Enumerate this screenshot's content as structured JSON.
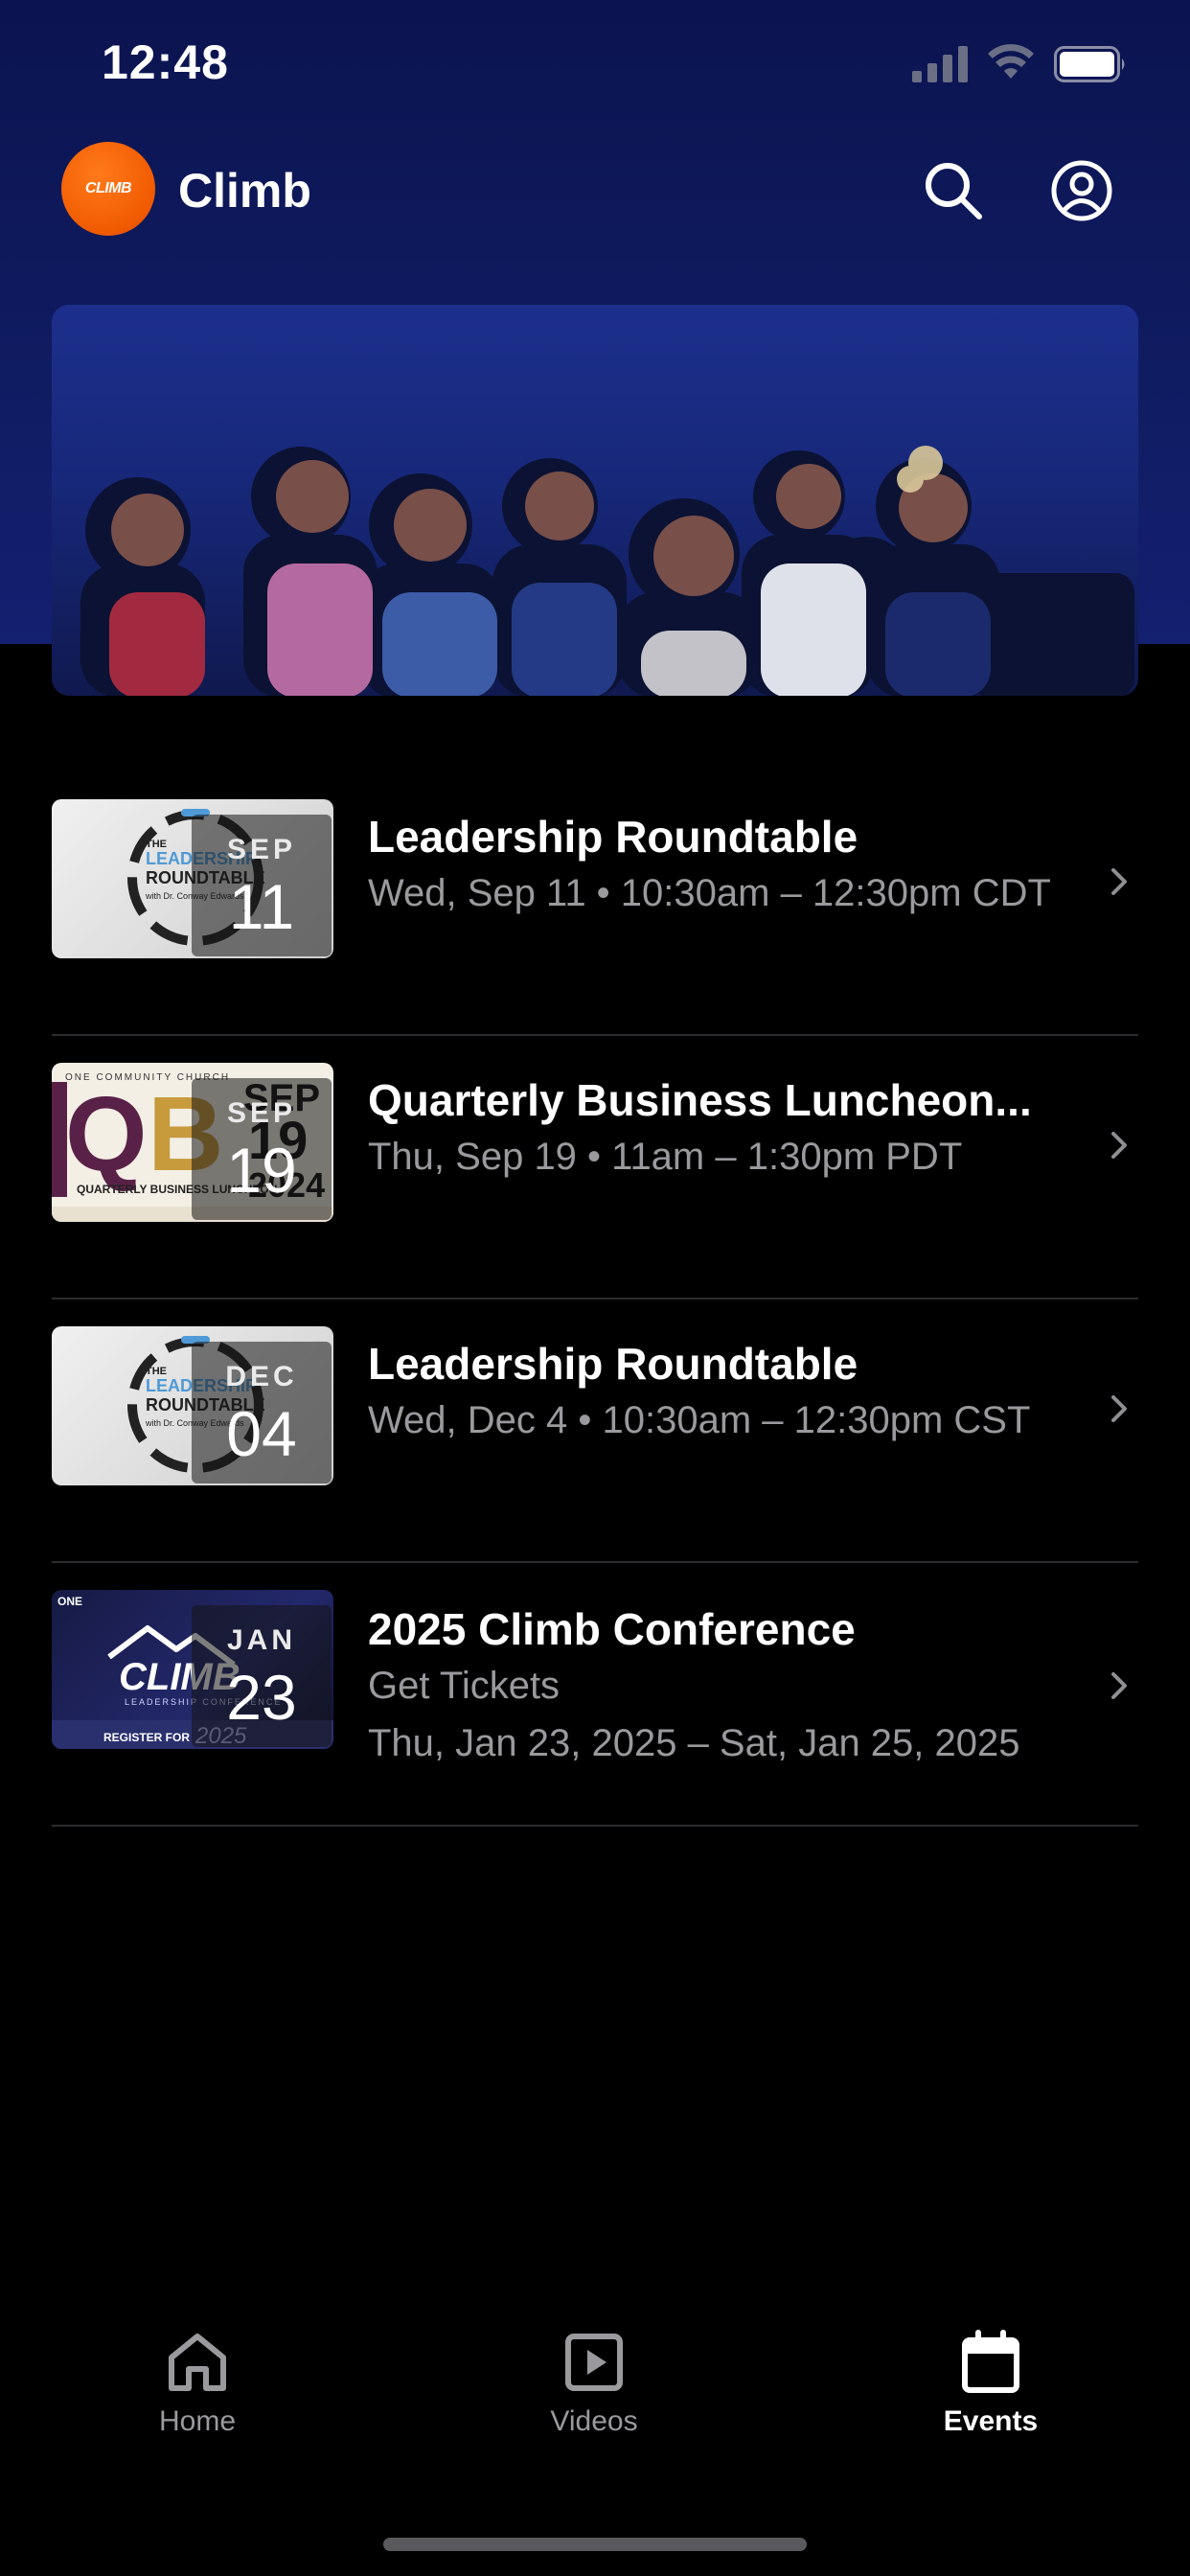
{
  "status_bar": {
    "time": "12:48"
  },
  "header": {
    "app_title": "Climb",
    "logo_text": "CLIMB"
  },
  "events": [
    {
      "title": "Leadership Roundtable",
      "subtitle": "Wed, Sep 11 • 10:30am – 12:30pm CDT",
      "month": "SEP",
      "day": "11",
      "thumb_text": "THE LEADERSHIP ROUNDTABLE with Dr. Conway Edwards"
    },
    {
      "title": "Quarterly Business Luncheon...",
      "subtitle": "Thu, Sep 19 • 11am – 1:30pm PDT",
      "month": "SEP",
      "day": "19",
      "thumb_text": "ONE COMMUNITY CHURCH QBL QUARTERLY BUSINESS LUNCHEON SEP 19 2024"
    },
    {
      "title": "Leadership Roundtable",
      "subtitle": "Wed, Dec 4 • 10:30am – 12:30pm CST",
      "month": "DEC",
      "day": "04",
      "thumb_text": "THE LEADERSHIP ROUNDTABLE with Dr. Conway Edwards"
    },
    {
      "title": "2025 Climb Conference",
      "subtitle": "Get Tickets",
      "subtitle2": "Thu, Jan 23, 2025 – Sat, Jan 25, 2025",
      "month": "JAN",
      "day": "23",
      "thumb_text": "ONE CLIMB LEADERSHIP CONFERENCE REGISTER FOR 2025"
    }
  ],
  "tabs": [
    {
      "label": "Home",
      "icon": "home-icon",
      "active": false
    },
    {
      "label": "Videos",
      "icon": "play-square-icon",
      "active": false
    },
    {
      "label": "Events",
      "icon": "calendar-icon",
      "active": true
    }
  ]
}
